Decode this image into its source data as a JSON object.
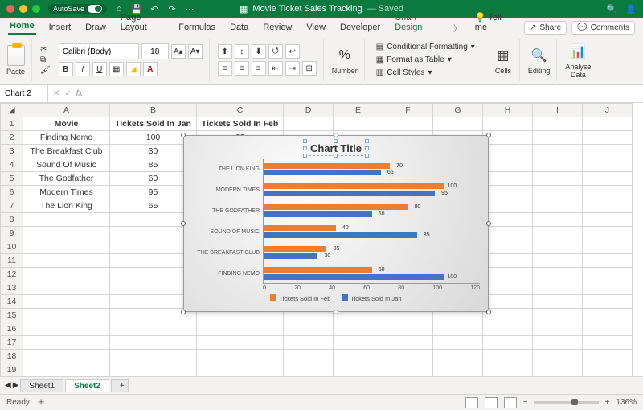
{
  "titlebar": {
    "autosave": "AutoSave",
    "doc": "Movie Ticket Sales Tracking",
    "saved": "— Saved"
  },
  "tabs": {
    "items": [
      "Home",
      "Insert",
      "Draw",
      "Page Layout",
      "Formulas",
      "Data",
      "Review",
      "View",
      "Developer",
      "Chart Design"
    ],
    "tellme": "Tell me",
    "share": "Share",
    "comments": "Comments"
  },
  "ribbon": {
    "paste": "Paste",
    "font": "Calibri (Body)",
    "size": "18",
    "number": "Number",
    "cf": "Conditional Formatting",
    "fat": "Format as Table",
    "cs": "Cell Styles",
    "cells": "Cells",
    "editing": "Editing",
    "analyse": "Analyse\nData"
  },
  "namebox": {
    "name": "Chart 2"
  },
  "columns": [
    "A",
    "B",
    "C",
    "D",
    "E",
    "F",
    "G",
    "H",
    "I",
    "J"
  ],
  "rows": [
    "1",
    "2",
    "3",
    "4",
    "5",
    "6",
    "7",
    "8",
    "9",
    "10",
    "11",
    "12",
    "13",
    "14",
    "15",
    "16",
    "17",
    "18",
    "19"
  ],
  "table": {
    "headers": [
      "Movie",
      "Tickets Sold In Jan",
      "Tickets Sold In Feb"
    ],
    "data": [
      [
        "Finding Nemo",
        "100",
        "60"
      ],
      [
        "The Breakfast Club",
        "30",
        "35"
      ],
      [
        "Sound Of Music",
        "85",
        "40"
      ],
      [
        "The Godfather",
        "60",
        "80"
      ],
      [
        "Modern Times",
        "95",
        "100"
      ],
      [
        "The Lion King",
        "65",
        "70"
      ]
    ]
  },
  "chart_data": {
    "type": "bar",
    "title": "Chart Title",
    "categories": [
      "THE LION KING",
      "MODERN TIMES",
      "THE GODFATHER",
      "SOUND OF MUSIC",
      "THE BREAKFAST CLUB",
      "FINDING NEMO"
    ],
    "series": [
      {
        "name": "Tickets Sold In Feb",
        "values": [
          70,
          100,
          80,
          40,
          35,
          60
        ],
        "color": "#ed7d31"
      },
      {
        "name": "Tickets Sold In Jan",
        "values": [
          65,
          95,
          60,
          85,
          30,
          100
        ],
        "color": "#4472c4"
      }
    ],
    "xticks": [
      0,
      20,
      40,
      60,
      80,
      100,
      120
    ],
    "xlim": [
      0,
      120
    ]
  },
  "sheets": {
    "s1": "Sheet1",
    "s2": "Sheet2"
  },
  "status": {
    "ready": "Ready",
    "zoom": "136%"
  }
}
